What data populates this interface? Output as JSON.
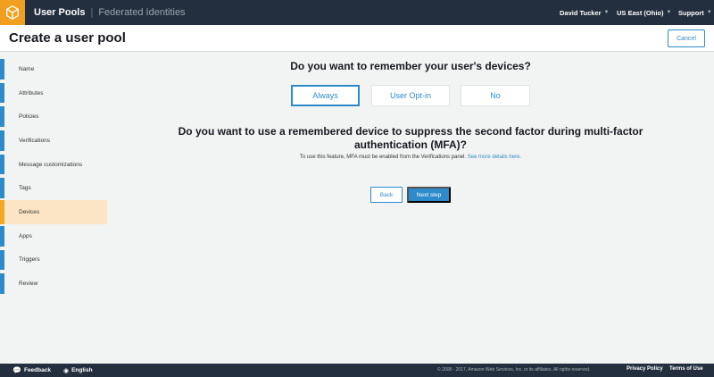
{
  "topbar": {
    "service": "User Pools",
    "secondary": "Federated Identities",
    "user": "David Tucker",
    "region": "US East (Ohio)",
    "support": "Support"
  },
  "header": {
    "title": "Create a user pool",
    "cancel_label": "Cancel"
  },
  "sidebar": {
    "items": [
      {
        "label": "Name"
      },
      {
        "label": "Attributes"
      },
      {
        "label": "Policies"
      },
      {
        "label": "Verifications"
      },
      {
        "label": "Message customizations"
      },
      {
        "label": "Tags"
      },
      {
        "label": "Devices",
        "active": true
      },
      {
        "label": "Apps"
      },
      {
        "label": "Triggers"
      },
      {
        "label": "Review"
      }
    ]
  },
  "main": {
    "question1": "Do you want to remember your user's devices?",
    "options": [
      {
        "label": "Always",
        "selected": true
      },
      {
        "label": "User Opt-in"
      },
      {
        "label": "No"
      }
    ],
    "question2": "Do you want to use a remembered device to suppress the second factor during multi-factor authentication (MFA)?",
    "info_text": "To use this feature, MFA must be enabled from the Verifications panel.",
    "info_link": "See more details here.",
    "back_label": "Back",
    "next_label": "Next step"
  },
  "footer": {
    "feedback": "Feedback",
    "language": "English",
    "copyright": "© 2008 - 2017, Amazon Web Services, Inc. or its affiliates. All rights reserved.",
    "privacy": "Privacy Policy",
    "terms": "Terms of Use"
  },
  "colors": {
    "nav_bg": "#232f3e",
    "accent": "#2e8bcb",
    "active_bg": "#fbe5c4",
    "active_bar": "#f5a623",
    "logo": "#f29e1f"
  }
}
